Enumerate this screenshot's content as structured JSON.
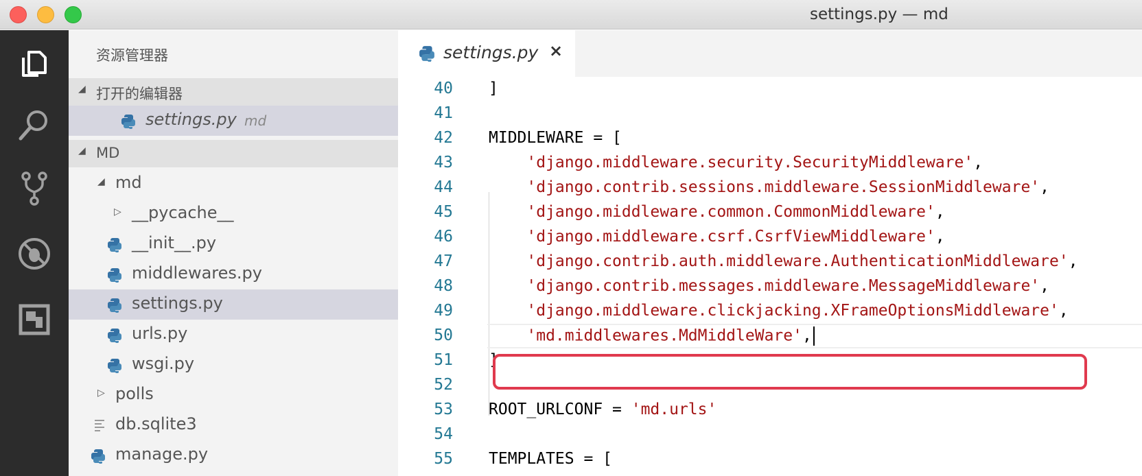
{
  "window": {
    "title": "settings.py — md"
  },
  "activity_bar": {
    "items": [
      "explorer-icon",
      "search-icon",
      "source-control-icon",
      "debug-icon",
      "extensions-icon"
    ]
  },
  "sidebar": {
    "title": "资源管理器",
    "open_editors": {
      "header": "打开的编辑器",
      "items": [
        {
          "label": "settings.py",
          "description": "md"
        }
      ]
    },
    "workspace": {
      "header": "MD",
      "tree": [
        {
          "label": "md",
          "kind": "folder-open"
        },
        {
          "label": "__pycache__",
          "kind": "folder-closed"
        },
        {
          "label": "__init__.py",
          "kind": "python"
        },
        {
          "label": "middlewares.py",
          "kind": "python"
        },
        {
          "label": "settings.py",
          "kind": "python"
        },
        {
          "label": "urls.py",
          "kind": "python"
        },
        {
          "label": "wsgi.py",
          "kind": "python"
        },
        {
          "label": "polls",
          "kind": "folder-closed"
        },
        {
          "label": "db.sqlite3",
          "kind": "file"
        },
        {
          "label": "manage.py",
          "kind": "python"
        }
      ]
    }
  },
  "editor": {
    "tab": {
      "label": "settings.py",
      "close": "×"
    },
    "lines": [
      {
        "n": "40",
        "code": "]"
      },
      {
        "n": "41",
        "code": ""
      },
      {
        "n": "42",
        "code": "MIDDLEWARE = ["
      },
      {
        "n": "43",
        "indent": "    ",
        "str": "'django.middleware.security.SecurityMiddleware'",
        "tail": ","
      },
      {
        "n": "44",
        "indent": "    ",
        "str": "'django.contrib.sessions.middleware.SessionMiddleware'",
        "tail": ","
      },
      {
        "n": "45",
        "indent": "    ",
        "str": "'django.middleware.common.CommonMiddleware'",
        "tail": ","
      },
      {
        "n": "46",
        "indent": "    ",
        "str": "'django.middleware.csrf.CsrfViewMiddleware'",
        "tail": ","
      },
      {
        "n": "47",
        "indent": "    ",
        "str": "'django.contrib.auth.middleware.AuthenticationMiddleware'",
        "tail": ","
      },
      {
        "n": "48",
        "indent": "    ",
        "str": "'django.contrib.messages.middleware.MessageMiddleware'",
        "tail": ","
      },
      {
        "n": "49",
        "indent": "    ",
        "str": "'django.middleware.clickjacking.XFrameOptionsMiddleware'",
        "tail": ","
      },
      {
        "n": "50",
        "indent": "    ",
        "str": "'md.middlewares.MdMiddleWare'",
        "tail": ","
      },
      {
        "n": "51",
        "code": "]"
      },
      {
        "n": "52",
        "code": ""
      },
      {
        "n": "53",
        "code": "ROOT_URLCONF = ",
        "str": "'md.urls'"
      },
      {
        "n": "54",
        "code": ""
      },
      {
        "n": "55",
        "code": "TEMPLATES = ["
      }
    ]
  },
  "colors": {
    "highlight_box": "#e03a4e",
    "string": "#a31515",
    "line_number": "#237893"
  }
}
